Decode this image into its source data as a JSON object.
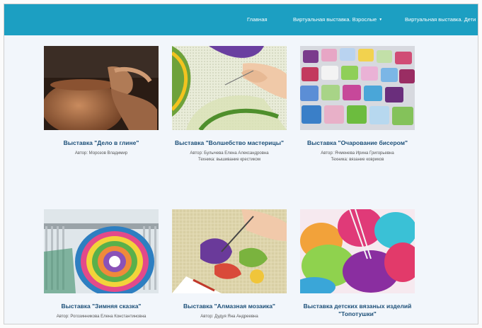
{
  "nav": {
    "home": "Главная",
    "adults": "Виртуальная выставка. Взрослые",
    "kids": "Виртуальная выставка. Дети"
  },
  "colors": {
    "navbar": "#1c9fc2",
    "title": "#1c4f78",
    "background": "#f2f6fb"
  },
  "cards": [
    {
      "title": "Выставка \"Дело в глине\"",
      "author": "Автор: Морозов Владимир",
      "technique": ""
    },
    {
      "title": "Выставка \"Волшебство мастерицы\"",
      "author": "Автор: Булычева Елена Александровна",
      "technique": "Техника: вышивание крестиком"
    },
    {
      "title": "Выставка \"Очарование бисером\"",
      "author": "Автор: Ячменева Ирина Григорьевна",
      "technique": "Техника: вязание ковриков"
    },
    {
      "title": "Выставка \"Зимняя сказка\"",
      "author": "Автор: Рогозинникова Елена Константиновна",
      "technique": ""
    },
    {
      "title": "Выставка \"Алмазная мозаика\"",
      "author": "Автор: Дудуя Яна Андреевна",
      "technique": ""
    },
    {
      "title": "Выставка детских вязаных изделий \"Топотушки\"",
      "author": "",
      "technique": ""
    }
  ]
}
